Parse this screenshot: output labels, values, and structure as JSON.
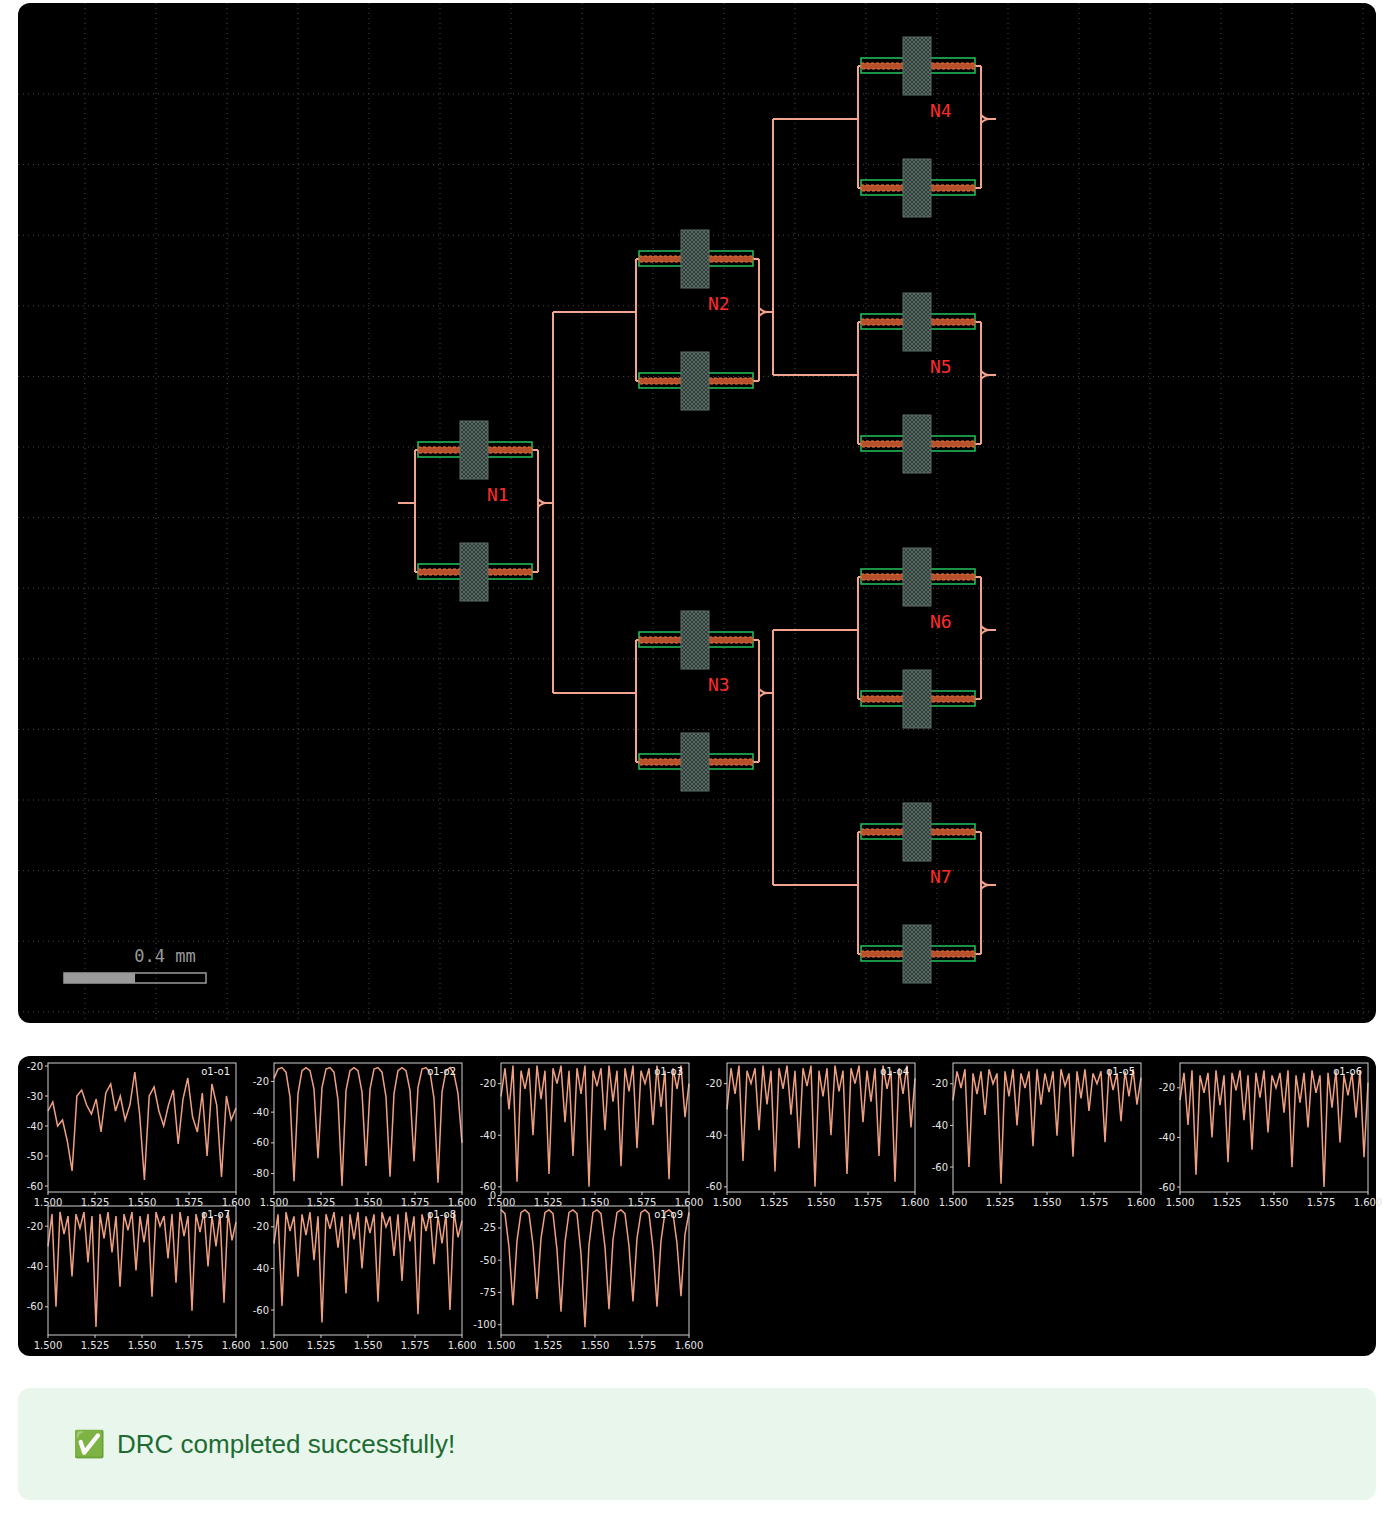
{
  "layout": {
    "nodes": [
      {
        "label": "N1"
      },
      {
        "label": "N2"
      },
      {
        "label": "N3"
      },
      {
        "label": "N4"
      },
      {
        "label": "N5"
      },
      {
        "label": "N6"
      },
      {
        "label": "N7"
      }
    ],
    "scale_bar": {
      "label": "0.4 mm",
      "level": 0.5
    }
  },
  "plots": {
    "x_ticks": [
      "1.500",
      "1.525",
      "1.550",
      "1.575",
      "1.600"
    ],
    "charts": [
      {
        "title": "o1-o1",
        "y_ticks": [
          "-20",
          "-30",
          "-40",
          "-50",
          "-60"
        ],
        "y_min": -62,
        "y_max": -19,
        "values": [
          -35,
          -32,
          -40,
          -38,
          -45,
          -55,
          -30,
          -28,
          -33,
          -36,
          -31,
          -42,
          -29,
          -26,
          -35,
          -30,
          -38,
          -33,
          -22,
          -36,
          -58,
          -30,
          -27,
          -35,
          -40,
          -33,
          -28,
          -46,
          -31,
          -24,
          -37,
          -42,
          -29,
          -50,
          -26,
          -33,
          -57,
          -30,
          -38,
          -34
        ]
      },
      {
        "title": "o1-o2",
        "y_ticks": [
          "-20",
          "-40",
          "-60",
          "-80"
        ],
        "y_min": -92,
        "y_max": -8,
        "values": [
          -18,
          -12,
          -11,
          -14,
          -30,
          -85,
          -28,
          -13,
          -11,
          -13,
          -25,
          -70,
          -24,
          -12,
          -11,
          -14,
          -32,
          -88,
          -26,
          -13,
          -11,
          -13,
          -27,
          -75,
          -25,
          -12,
          -11,
          -14,
          -30,
          -82,
          -28,
          -13,
          -11,
          -13,
          -26,
          -72,
          -24,
          -12,
          -11,
          -14,
          -31,
          -86,
          -27,
          -13,
          -11,
          -15,
          -28,
          -60
        ]
      },
      {
        "title": "o1-o3",
        "y_ticks": [
          "-20",
          "-40",
          "-60"
        ],
        "y_min": -62,
        "y_max": -12,
        "values": [
          -25,
          -14,
          -30,
          -13,
          -58,
          -15,
          -22,
          -14,
          -40,
          -13,
          -26,
          -15,
          -55,
          -14,
          -20,
          -13,
          -35,
          -15,
          -48,
          -14,
          -24,
          -13,
          -60,
          -15,
          -21,
          -14,
          -38,
          -13,
          -27,
          -15,
          -52,
          -14,
          -23,
          -13,
          -45,
          -15,
          -20,
          -14,
          -36,
          -13,
          -29,
          -15,
          -57,
          -14,
          -22,
          -13,
          -33,
          -20
        ]
      },
      {
        "title": "o1-o4",
        "y_ticks": [
          "-20",
          "-40",
          "-60"
        ],
        "y_min": -62,
        "y_max": -12,
        "values": [
          -30,
          -14,
          -24,
          -13,
          -50,
          -15,
          -20,
          -14,
          -38,
          -13,
          -28,
          -15,
          -54,
          -14,
          -22,
          -13,
          -32,
          -15,
          -45,
          -14,
          -21,
          -13,
          -60,
          -15,
          -25,
          -14,
          -40,
          -13,
          -23,
          -15,
          -55,
          -14,
          -20,
          -13,
          -35,
          -15,
          -27,
          -14,
          -48,
          -13,
          -22,
          -15,
          -58,
          -14,
          -24,
          -13,
          -37,
          -18
        ]
      },
      {
        "title": "o1-o5",
        "y_ticks": [
          "-20",
          "-40",
          "-60"
        ],
        "y_min": -72,
        "y_max": -10,
        "values": [
          -28,
          -14,
          -22,
          -13,
          -60,
          -15,
          -25,
          -14,
          -35,
          -13,
          -20,
          -15,
          -68,
          -14,
          -26,
          -13,
          -40,
          -15,
          -22,
          -14,
          -50,
          -13,
          -30,
          -15,
          -24,
          -14,
          -45,
          -13,
          -21,
          -15,
          -55,
          -14,
          -27,
          -13,
          -33,
          -15,
          -20,
          -14,
          -48,
          -13,
          -23,
          -15,
          -38,
          -14,
          -26,
          -13,
          -30,
          -17
        ]
      },
      {
        "title": "o1-o6",
        "y_ticks": [
          "-20",
          "-40",
          "-60"
        ],
        "y_min": -62,
        "y_max": -10,
        "values": [
          -25,
          -14,
          -35,
          -13,
          -55,
          -15,
          -22,
          -14,
          -40,
          -13,
          -27,
          -15,
          -50,
          -14,
          -21,
          -13,
          -33,
          -15,
          -45,
          -14,
          -24,
          -13,
          -38,
          -15,
          -20,
          -14,
          -30,
          -13,
          -52,
          -15,
          -26,
          -14,
          -36,
          -13,
          -22,
          -15,
          -60,
          -14,
          -28,
          -13,
          -42,
          -15,
          -23,
          -14,
          -32,
          -13,
          -48,
          -18
        ]
      },
      {
        "title": "o1-o7",
        "y_ticks": [
          "-20",
          "-40",
          "-60"
        ],
        "y_min": -74,
        "y_max": -10,
        "values": [
          -30,
          -14,
          -60,
          -13,
          -24,
          -15,
          -45,
          -14,
          -21,
          -13,
          -38,
          -15,
          -70,
          -14,
          -26,
          -13,
          -33,
          -15,
          -50,
          -14,
          -22,
          -13,
          -42,
          -15,
          -28,
          -14,
          -55,
          -13,
          -20,
          -15,
          -36,
          -14,
          -48,
          -13,
          -25,
          -15,
          -62,
          -14,
          -23,
          -13,
          -40,
          -15,
          -30,
          -14,
          -58,
          -13,
          -27,
          -18
        ]
      },
      {
        "title": "o1-o8",
        "y_ticks": [
          "-20",
          "-40",
          "-60"
        ],
        "y_min": -72,
        "y_max": -10,
        "values": [
          -28,
          -14,
          -58,
          -13,
          -22,
          -15,
          -44,
          -14,
          -24,
          -13,
          -36,
          -15,
          -66,
          -14,
          -21,
          -13,
          -30,
          -15,
          -52,
          -14,
          -26,
          -13,
          -40,
          -15,
          -23,
          -14,
          -56,
          -13,
          -20,
          -15,
          -34,
          -14,
          -46,
          -13,
          -27,
          -15,
          -62,
          -14,
          -22,
          -13,
          -38,
          -15,
          -28,
          -14,
          -60,
          -13,
          -25,
          -17
        ]
      },
      {
        "title": "o1-o9",
        "y_ticks": [
          "0",
          "-25",
          "-50",
          "-75",
          "-100"
        ],
        "y_min": -108,
        "y_max": -8,
        "values": [
          -11,
          -14,
          -40,
          -85,
          -35,
          -13,
          -11,
          -14,
          -38,
          -80,
          -33,
          -13,
          -11,
          -14,
          -42,
          -90,
          -36,
          -13,
          -11,
          -14,
          -45,
          -102,
          -38,
          -13,
          -11,
          -14,
          -40,
          -88,
          -34,
          -13,
          -11,
          -14,
          -39,
          -82,
          -33,
          -13,
          -11,
          -14,
          -41,
          -86,
          -35,
          -13,
          -11,
          -14,
          -37,
          -78,
          -30,
          -13
        ]
      }
    ]
  },
  "banner": {
    "icon": "✅",
    "text": "DRC completed successfully!"
  }
}
